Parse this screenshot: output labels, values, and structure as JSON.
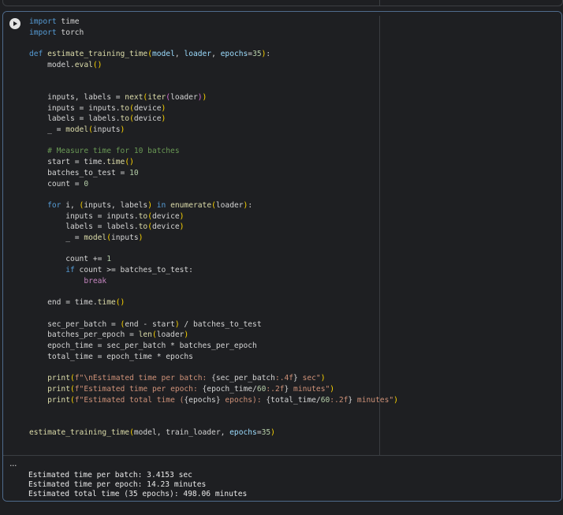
{
  "cell": {
    "run_button_label": "Run cell",
    "code_lines": [
      "import time",
      "import torch",
      "",
      "def estimate_training_time(model, loader, epochs=35):",
      "    model.eval()",
      "",
      "",
      "    inputs, labels = next(iter(loader))",
      "    inputs = inputs.to(device)",
      "    labels = labels.to(device)",
      "    _ = model(inputs)",
      "",
      "    # Measure time for 10 batches",
      "    start = time.time()",
      "    batches_to_test = 10",
      "    count = 0",
      "",
      "    for i, (inputs, labels) in enumerate(loader):",
      "        inputs = inputs.to(device)",
      "        labels = labels.to(device)",
      "        _ = model(inputs)",
      "",
      "        count += 1",
      "        if count >= batches_to_test:",
      "            break",
      "",
      "    end = time.time()",
      "",
      "    sec_per_batch = (end - start) / batches_to_test",
      "    batches_per_epoch = len(loader)",
      "    epoch_time = sec_per_batch * batches_per_epoch",
      "    total_time = epoch_time * epochs",
      "",
      "    print(f\"\\nEstimated time per batch: {sec_per_batch:.4f} sec\")",
      "    print(f\"Estimated time per epoch: {epoch_time/60:.2f} minutes\")",
      "    print(f\"Estimated total time ({epochs} epochs): {total_time/60:.2f} minutes\")",
      "",
      "",
      "estimate_training_time(model, train_loader, epochs=35)"
    ]
  },
  "output": {
    "menu_label": "...",
    "lines": [
      "Estimated time per batch: 3.4153 sec",
      "Estimated time per epoch: 14.23 minutes",
      "Estimated total time (35 epochs): 498.06 minutes"
    ]
  },
  "colors": {
    "background": "#1e1f22",
    "cell_border": "#4f6b8c",
    "keyword": "#569cd6",
    "function": "#dcdcaa",
    "parameter": "#9cdcfe",
    "number": "#b5cea8",
    "string": "#ce9178",
    "comment": "#6a9955",
    "bracket": "#ffd700"
  }
}
